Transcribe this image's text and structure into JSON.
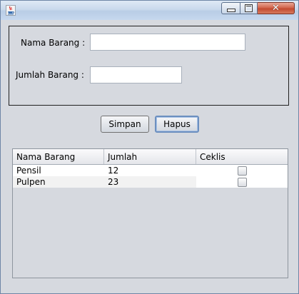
{
  "window": {
    "title": ""
  },
  "form": {
    "nama_label": "Nama Barang :",
    "nama_value": "",
    "jumlah_label": "Jumlah Barang :",
    "jumlah_value": ""
  },
  "buttons": {
    "simpan": "Simpan",
    "hapus": "Hapus"
  },
  "table": {
    "headers": [
      "Nama Barang",
      "Jumlah",
      "Ceklis"
    ],
    "rows": [
      {
        "nama": "Pensil",
        "jumlah": "12",
        "checked": false
      },
      {
        "nama": "Pulpen",
        "jumlah": "23",
        "checked": false
      }
    ]
  },
  "icons": {
    "app": "java-cup-icon",
    "minimize": "minimize-icon",
    "maximize": "maximize-icon",
    "close": "close-icon"
  },
  "colors": {
    "focus_border": "#6c8fbf",
    "close_button": "#c24a30"
  }
}
